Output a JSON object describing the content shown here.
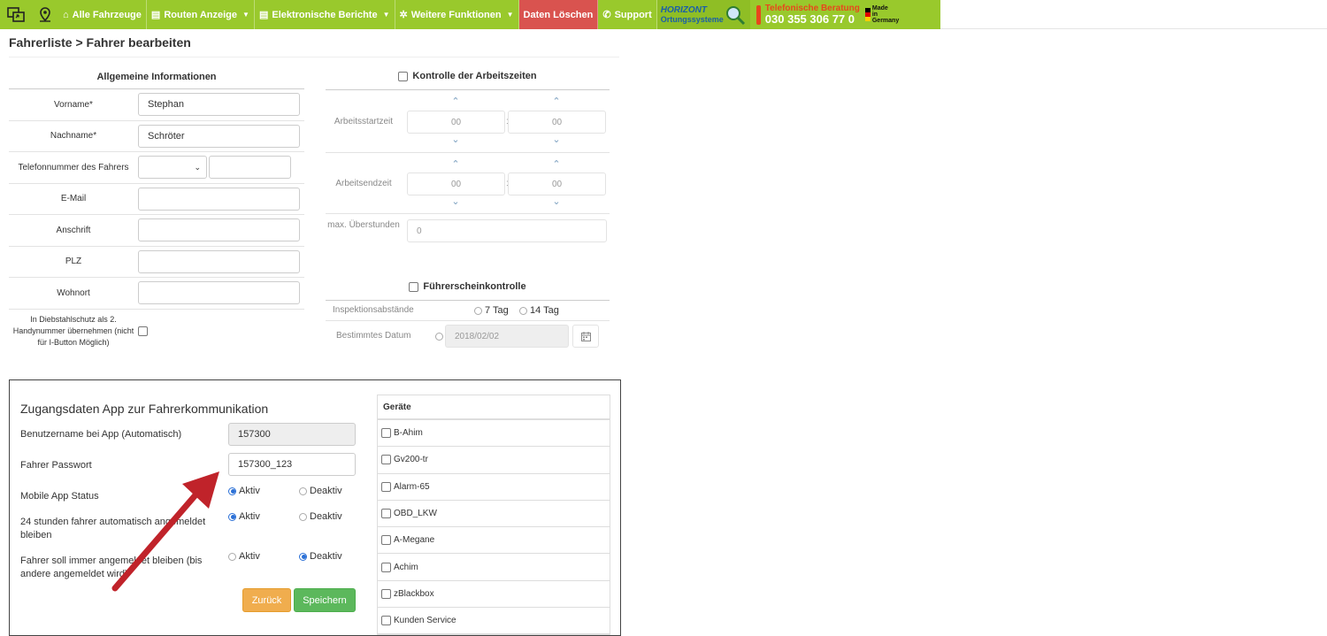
{
  "nav": {
    "items": [
      {
        "label": "Alle Fahrzeuge",
        "icon": "home-icon",
        "caret": false
      },
      {
        "label": "Routen Anzeige",
        "icon": "list-icon",
        "caret": true
      },
      {
        "label": "Elektronische Berichte",
        "icon": "report-icon",
        "caret": true
      },
      {
        "label": "Weitere Funktionen",
        "icon": "gear-icon",
        "caret": true
      },
      {
        "label": "Daten Löschen",
        "icon": "",
        "caret": false
      },
      {
        "label": "Support",
        "icon": "phone-icon",
        "caret": false
      }
    ],
    "logo_top": "HORIZONT",
    "logo_bottom": "Ortungssysteme",
    "phone_label": "Telefonische Beratung",
    "phone_number": "030 355 306 77 0",
    "made": [
      "Made",
      "in",
      "Germany"
    ],
    "colors": {
      "bar": "#99c92c",
      "danger": "#d9534f"
    }
  },
  "breadcrumb": "Fahrerliste > Fahrer bearbeiten",
  "general": {
    "title": "Allgemeine Informationen",
    "fields": {
      "vorname_label": "Vorname*",
      "vorname": "Stephan",
      "nachname_label": "Nachname*",
      "nachname": "Schröter",
      "telefon_label": "Telefonnummer des Fahrers",
      "email_label": "E-Mail",
      "anschrift_label": "Anschrift",
      "plz_label": "PLZ",
      "wohnort_label": "Wohnort",
      "diebstahl_label": "In Diebstahlschutz als 2. Handynummer übernehmen (nicht für I-Button Möglich)"
    }
  },
  "worktime": {
    "title": "Kontrolle der Arbeitszeiten",
    "start_label": "Arbeitsstartzeit",
    "end_label": "Arbeitsendzeit",
    "start_h": "00",
    "start_m": "00",
    "end_h": "00",
    "end_m": "00",
    "overtime_label": "max. Überstunden",
    "overtime_value": "0",
    "colon": ":",
    "up": "⌃",
    "down": "⌄"
  },
  "license": {
    "title": "Führerscheinkontrolle",
    "interval_label": "Inspektionsabstände",
    "opt7": "7 Tag",
    "opt14": "14 Tag",
    "date_label": "Bestimmtes Datum",
    "date_value": "2018/02/02"
  },
  "app": {
    "title": "Zugangsdaten App zur Fahrerkommunikation",
    "username_label": "Benutzername bei App (Automatisch)",
    "username": "157300",
    "password_label": "Fahrer Passwort",
    "password": "157300_123",
    "status_label": "Mobile App Status",
    "auto_login_label": "24 stunden fahrer automatisch angemeldet bleiben",
    "always_login_label": "Fahrer soll immer angemeldet bleiben (bis andere angemeldet wird)",
    "aktiv": "Aktiv",
    "deaktiv": "Deaktiv",
    "back": "Zurück",
    "save": "Speichern"
  },
  "devices": {
    "title": "Geräte",
    "items": [
      "B-Ahim",
      "Gv200-tr",
      "Alarm-65",
      "OBD_LKW",
      "A-Megane",
      "Achim",
      "zBlackbox",
      "Kunden Service"
    ]
  }
}
